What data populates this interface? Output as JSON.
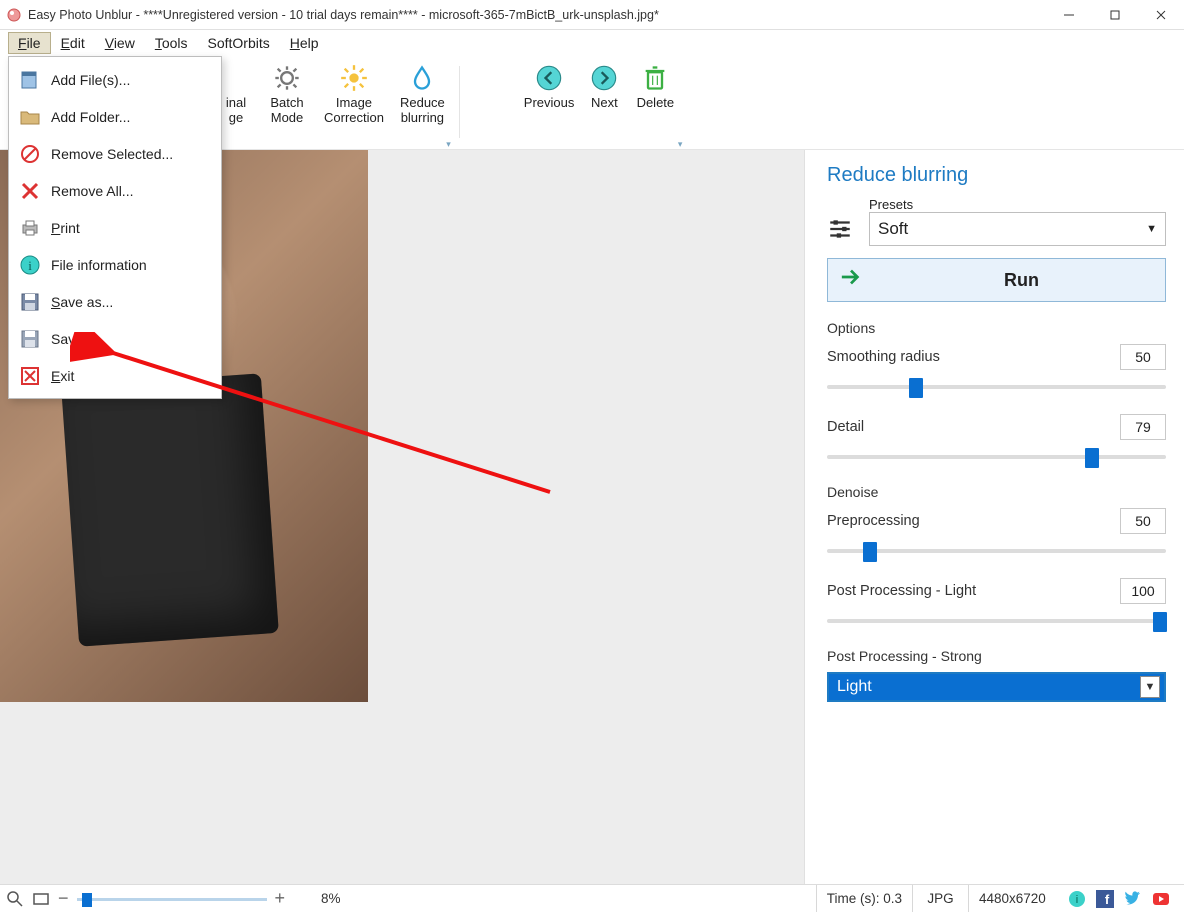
{
  "titlebar": {
    "title": "Easy Photo Unblur - ****Unregistered version - 10 trial days remain**** - microsoft-365-7mBictB_urk-unsplash.jpg*"
  },
  "menubar": {
    "items": [
      "File",
      "Edit",
      "View",
      "Tools",
      "SoftOrbits",
      "Help"
    ],
    "open_index": 0
  },
  "file_menu": {
    "items": [
      {
        "label": "Add File(s)...",
        "icon": "file-icon"
      },
      {
        "label": "Add Folder...",
        "icon": "folder-icon"
      },
      {
        "label": "Remove Selected...",
        "icon": "remove-selected-icon"
      },
      {
        "label": "Remove All...",
        "icon": "remove-all-icon"
      },
      {
        "label": "Print",
        "icon": "print-icon",
        "underline": true
      },
      {
        "label": "File information",
        "icon": "info-icon"
      },
      {
        "label": "Save as...",
        "icon": "save-as-icon",
        "underline": true
      },
      {
        "label": "Save",
        "icon": "save-icon"
      },
      {
        "label": "Exit",
        "icon": "exit-icon",
        "underline": true
      }
    ]
  },
  "toolbar": {
    "original_l1": "inal",
    "original_l2": "ge",
    "batch_l1": "Batch",
    "batch_l2": "Mode",
    "correction_l1": "Image",
    "correction_l2": "Correction",
    "reduce_l1": "Reduce",
    "reduce_l2": "blurring",
    "previous": "Previous",
    "next": "Next",
    "delete": "Delete"
  },
  "side": {
    "title": "Reduce blurring",
    "presets_label": "Presets",
    "preset_value": "Soft",
    "run": "Run",
    "options_label": "Options",
    "smoothing_label": "Smoothing radius",
    "smoothing_value": "50",
    "detail_label": "Detail",
    "detail_value": "79",
    "denoise_label": "Denoise",
    "preprocessing_label": "Preprocessing",
    "preprocessing_value": "50",
    "pplight_label": "Post Processing - Light",
    "pplight_value": "100",
    "ppstrong_label": "Post Processing - Strong",
    "ppstrong_value": "Light"
  },
  "status": {
    "zoom_pct": "8%",
    "time": "Time (s): 0.3",
    "format": "JPG",
    "dims": "4480x6720"
  },
  "slider_positions": {
    "smoothing_pct": 25,
    "detail_pct": 79,
    "preprocessing_pct": 11,
    "pplight_pct": 100,
    "zoom_pct": 3
  }
}
